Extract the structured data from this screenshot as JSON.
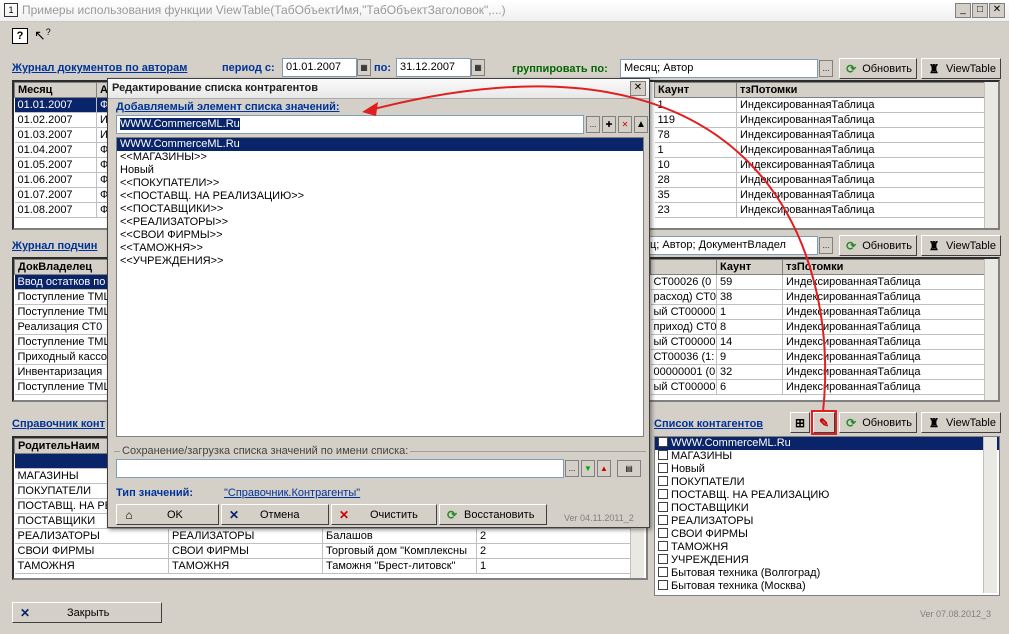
{
  "window": {
    "title": "Примеры использования функции   ViewTable(ТабОбъектИмя,\"ТабОбъектЗаголовок\",...)"
  },
  "toolbar": {
    "help": "?",
    "whatsthis": "?"
  },
  "section1": {
    "title": "Журнал документов по авторам",
    "period_from_label": "период с:",
    "date_from": "01.01.2007",
    "period_to_label": "по:",
    "date_to": "31.12.2007",
    "group_label": "группировать по:",
    "group_value": "Месяц; Автор",
    "refresh": "Обновить",
    "viewtable": "ViewTable",
    "cols": [
      "Месяц",
      "А",
      "Каунт",
      "тзПотомки"
    ],
    "rows": [
      {
        "month": "01.01.2007",
        "a": "Ф",
        "count": "1",
        "child": "ИндексированнаяТаблица"
      },
      {
        "month": "01.02.2007",
        "a": "И",
        "count": "119",
        "child": "ИндексированнаяТаблица"
      },
      {
        "month": "01.03.2007",
        "a": "И",
        "count": "78",
        "child": "ИндексированнаяТаблица"
      },
      {
        "month": "01.04.2007",
        "a": "Ф",
        "count": "1",
        "child": "ИндексированнаяТаблица"
      },
      {
        "month": "01.05.2007",
        "a": "Ф",
        "count": "10",
        "child": "ИндексированнаяТаблица"
      },
      {
        "month": "01.06.2007",
        "a": "Ф",
        "count": "28",
        "child": "ИндексированнаяТаблица"
      },
      {
        "month": "01.07.2007",
        "a": "Ф",
        "count": "35",
        "child": "ИндексированнаяТаблица"
      },
      {
        "month": "01.08.2007",
        "a": "Ф",
        "count": "23",
        "child": "ИндексированнаяТаблица"
      }
    ]
  },
  "section2": {
    "title": "Журнал подчин",
    "group_value": "ц; Автор; ДокументВладел",
    "refresh": "Обновить",
    "viewtable": "ViewTable",
    "cols": [
      "ДокВладелец",
      "Каунт",
      "тзПотомки"
    ],
    "rows": [
      {
        "owner": "Ввод остатков по",
        "mid": "СТ00026 (0",
        "count": "59",
        "child": "ИндексированнаяТаблица"
      },
      {
        "owner": "Поступление ТМЦ",
        "mid": "расход) СТ0",
        "count": "38",
        "child": "ИндексированнаяТаблица"
      },
      {
        "owner": "Поступление ТМЦ",
        "mid": "ый СТ000000",
        "count": "1",
        "child": "ИндексированнаяТаблица"
      },
      {
        "owner": "Реализация  СТ0",
        "mid": "приход) СТ0",
        "count": "8",
        "child": "ИндексированнаяТаблица"
      },
      {
        "owner": "Поступление ТМЦ",
        "mid": "ый СТ000000",
        "count": "14",
        "child": "ИндексированнаяТаблица"
      },
      {
        "owner": "Приходный кассо",
        "mid": "СТ00036 (1:",
        "count": "9",
        "child": "ИндексированнаяТаблица"
      },
      {
        "owner": "Инвентаризация",
        "mid": "00000001 (0",
        "count": "32",
        "child": "ИндексированнаяТаблица"
      },
      {
        "owner": "Поступление ТМЦ",
        "mid": "ый СТ000000",
        "count": "6",
        "child": "ИндексированнаяТаблица"
      }
    ]
  },
  "section3": {
    "title": "Справочник конт",
    "cols": [
      "РодительНаим"
    ],
    "rows": [
      {
        "a": "",
        "b": "",
        "c": "",
        "d": ""
      },
      {
        "a": "МАГАЗИНЫ",
        "b": "",
        "c": "",
        "d": ""
      },
      {
        "a": "ПОКУПАТЕЛИ",
        "b": "",
        "c": "",
        "d": ""
      },
      {
        "a": "ПОСТАВЩ. НА РЕ",
        "b": "",
        "c": "",
        "d": ""
      },
      {
        "a": "ПОСТАВЩИКИ",
        "b": "",
        "c": "",
        "d": ""
      },
      {
        "a": "РЕАЛИЗАТОРЫ",
        "b": "РЕАЛИЗАТОРЫ",
        "c": "Балашов",
        "d": "2"
      },
      {
        "a": "СВОИ ФИРМЫ",
        "b": "СВОИ ФИРМЫ",
        "c": "Торговый дом \"Комплексны",
        "d": "2"
      },
      {
        "a": "ТАМОЖНЯ",
        "b": "ТАМОЖНЯ",
        "c": "Таможня \"Брест-литовск\"",
        "d": "1"
      }
    ]
  },
  "contragents": {
    "title": "Список контагентов",
    "refresh": "Обновить",
    "viewtable": "ViewTable",
    "items": [
      "WWW.CommerceML.Ru",
      "МАГАЗИНЫ",
      "Новый",
      "ПОКУПАТЕЛИ",
      "ПОСТАВЩ. НА РЕАЛИЗАЦИЮ",
      "ПОСТАВЩИКИ",
      "РЕАЛИЗАТОРЫ",
      "СВОИ ФИРМЫ",
      "ТАМОЖНЯ",
      "УЧРЕЖДЕНИЯ",
      "Бытовая техника (Волгоград)",
      "Бытовая техника (Москва)"
    ]
  },
  "dialog": {
    "title": "Редактирование списка контрагентов",
    "add_label": "Добавляемый элемент списка значений:",
    "add_value": "WWW.CommerceML.Ru",
    "items": [
      "WWW.CommerceML.Ru",
      "<<МАГАЗИНЫ>>",
      "Новый",
      "<<ПОКУПАТЕЛИ>>",
      "<<ПОСТАВЩ. НА РЕАЛИЗАЦИЮ>>",
      "<<ПОСТАВЩИКИ>>",
      "<<РЕАЛИЗАТОРЫ>>",
      "<<СВОИ ФИРМЫ>>",
      "<<ТАМОЖНЯ>>",
      "<<УЧРЕЖДЕНИЯ>>"
    ],
    "save_label": "Сохранение/загрузка списка значений по имени списка:",
    "type_label": "Тип значений:",
    "type_value": "\"Справочник.Контрагенты\"",
    "ok": "OK",
    "cancel": "Отмена",
    "clear": "Очистить",
    "restore": "Восстановить",
    "version": "Ver 04.11.2011_2"
  },
  "footer": {
    "close": "Закрыть",
    "version": "Ver 07.08.2012_3"
  },
  "colors": {
    "selection": "#0a246a",
    "link": "#003399",
    "arrow": "#e02020"
  }
}
